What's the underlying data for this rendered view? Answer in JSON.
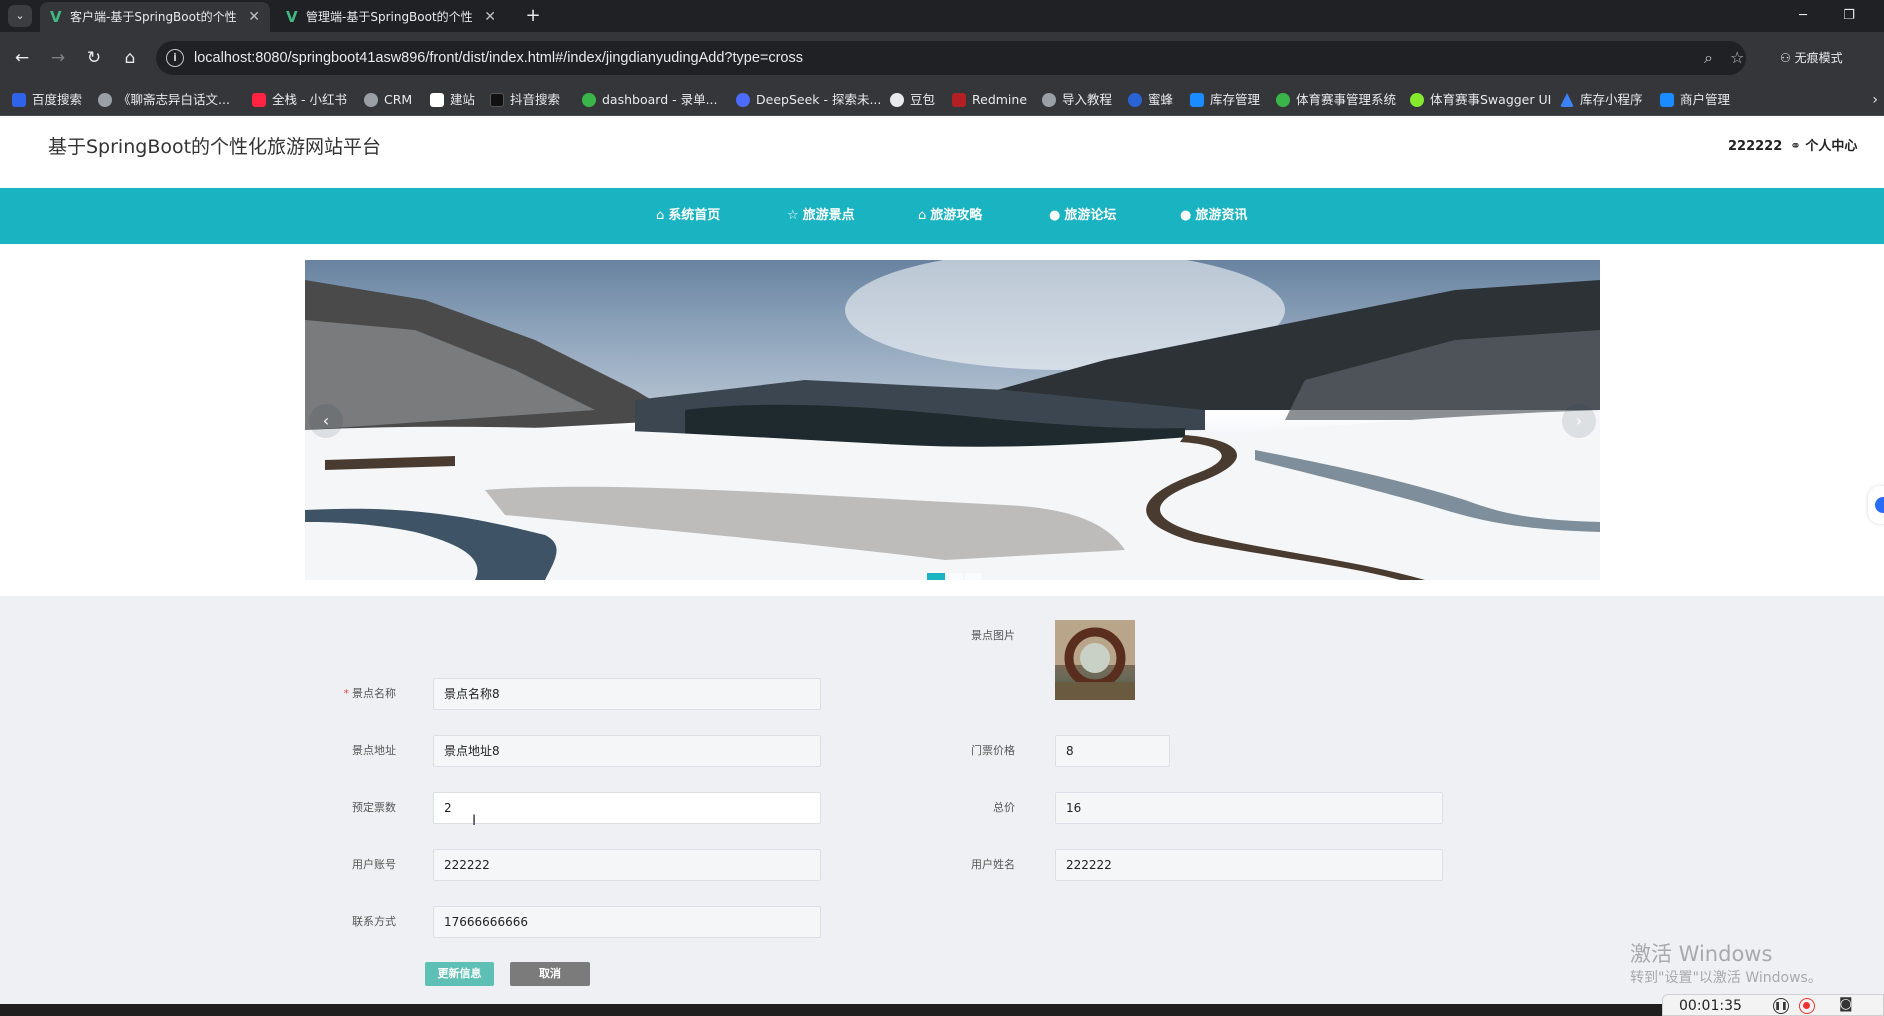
{
  "browser": {
    "tabs": [
      {
        "title": "客户端-基于SpringBoot的个性",
        "active": true
      },
      {
        "title": "管理端-基于SpringBoot的个性",
        "active": false
      }
    ],
    "url": "localhost:8080/springboot41asw896/front/dist/index.html#/index/jingdianyudingAdd?type=cross",
    "profile_label": "无痕模式",
    "bookmarks": [
      {
        "label": "百度搜索",
        "icon": "paw-icon",
        "color": "#2f64e8"
      },
      {
        "label": "《聊斋志异白话文...",
        "icon": "globe-icon",
        "color": "#9aa0a6"
      },
      {
        "label": "全栈 - 小红书",
        "icon": "xiaohongshu-icon",
        "color": "#ff2442"
      },
      {
        "label": "CRM",
        "icon": "globe-icon",
        "color": "#9aa0a6"
      },
      {
        "label": "建站",
        "icon": "c-icon",
        "color": "#ffffff"
      },
      {
        "label": "抖音搜索",
        "icon": "douyin-icon",
        "color": "#111111"
      },
      {
        "label": "dashboard - 录单...",
        "icon": "leaf-icon",
        "color": "#3ab54a"
      },
      {
        "label": "DeepSeek - 探索未...",
        "icon": "deepseek-icon",
        "color": "#4d6bfe"
      },
      {
        "label": "豆包",
        "icon": "doubao-icon",
        "color": "#e8eaed"
      },
      {
        "label": "Redmine",
        "icon": "redmine-icon",
        "color": "#b32024"
      },
      {
        "label": "导入教程",
        "icon": "globe-icon",
        "color": "#9aa0a6"
      },
      {
        "label": "蜜蜂",
        "icon": "shield-icon",
        "color": "#2a63d6"
      },
      {
        "label": "库存管理",
        "icon": "app-icon",
        "color": "#1a8cff"
      },
      {
        "label": "体育赛事管理系统",
        "icon": "leaf-icon",
        "color": "#3ab54a"
      },
      {
        "label": "体育赛事Swagger UI",
        "icon": "swagger-icon",
        "color": "#85ea2d"
      },
      {
        "label": "库存小程序",
        "icon": "triangle-icon",
        "color": "#3b82f6"
      },
      {
        "label": "商户管理",
        "icon": "app-icon",
        "color": "#1a8cff"
      }
    ]
  },
  "site": {
    "title": "基于SpringBoot的个性化旅游网站平台",
    "username": "222222",
    "user_center": "个人中心"
  },
  "nav": [
    {
      "label": "系统首页",
      "icon": "home-icon",
      "glyph": "⌂"
    },
    {
      "label": "旅游景点",
      "icon": "star-icon",
      "glyph": "☆"
    },
    {
      "label": "旅游攻略",
      "icon": "home-icon",
      "glyph": "⌂"
    },
    {
      "label": "旅游论坛",
      "icon": "info-icon",
      "glyph": "●"
    },
    {
      "label": "旅游资讯",
      "icon": "info-icon",
      "glyph": "●"
    }
  ],
  "carousel": {
    "slides": 3,
    "active_index": 0
  },
  "form": {
    "image_label": "景点图片",
    "fields": {
      "name": {
        "label": "景点名称",
        "value": "景点名称8",
        "required": true
      },
      "address": {
        "label": "景点地址",
        "value": "景点地址8"
      },
      "ticket_price": {
        "label": "门票价格",
        "value": "8"
      },
      "ticket_count": {
        "label": "预定票数",
        "value": "2"
      },
      "total": {
        "label": "总价",
        "value": "16"
      },
      "account": {
        "label": "用户账号",
        "value": "222222"
      },
      "user_name": {
        "label": "用户姓名",
        "value": "222222"
      },
      "contact": {
        "label": "联系方式",
        "value": "17666666666"
      }
    },
    "submit_label": "更新信息",
    "cancel_label": "取消"
  },
  "os": {
    "watermark_title": "激活 Windows",
    "watermark_sub": "转到\"设置\"以激活 Windows。",
    "recorder_time": "00:01:35"
  },
  "colors": {
    "brand": "#1ab3c1",
    "primary_button": "#5ec0b4",
    "cancel_button": "#7b7b7b"
  }
}
